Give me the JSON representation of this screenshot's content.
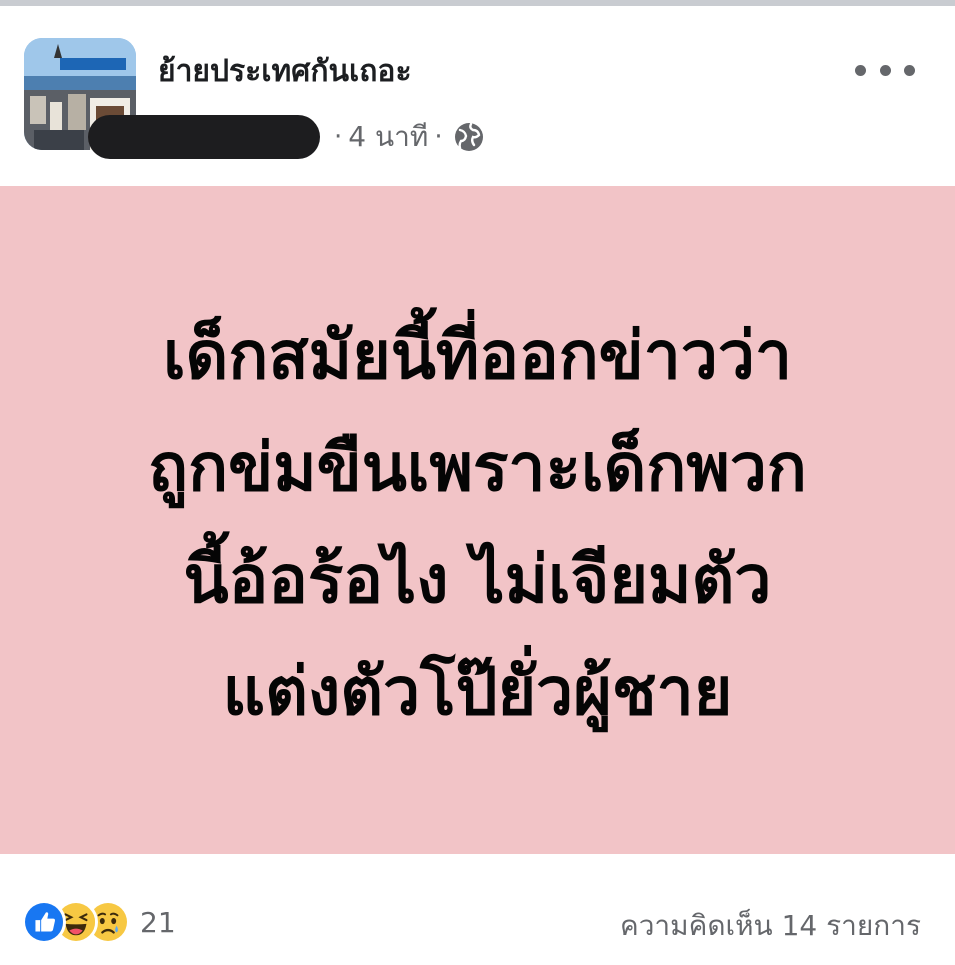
{
  "post": {
    "page_name": "ย้ายประเทศกันเถอะ",
    "time_ago": "4 นาที",
    "separator": "·",
    "icons": {
      "more": "more-dots-icon",
      "privacy": "globe-icon",
      "avatar": "page-avatar"
    },
    "background_color": "#f2c4c7",
    "text_lines": [
      "เด็กสมัยนี้ที่ออกข่าวว่า",
      "ถูกข่มขืนเพราะเด็กพวก",
      "นี้อ้อร้อไง ไม่เจียมตัว",
      "แต่งตัวโป๊ยั่วผู้ชาย"
    ]
  },
  "footer": {
    "reactions": [
      "like-reaction-icon",
      "haha-reaction-icon",
      "sad-reaction-icon"
    ],
    "reaction_count": "21",
    "comments_label": "ความคิดเห็น 14 รายการ"
  },
  "colors": {
    "like_blue": "#1877f2",
    "emoji_yellow": "#f7c843",
    "secondary_text": "#65676b"
  }
}
